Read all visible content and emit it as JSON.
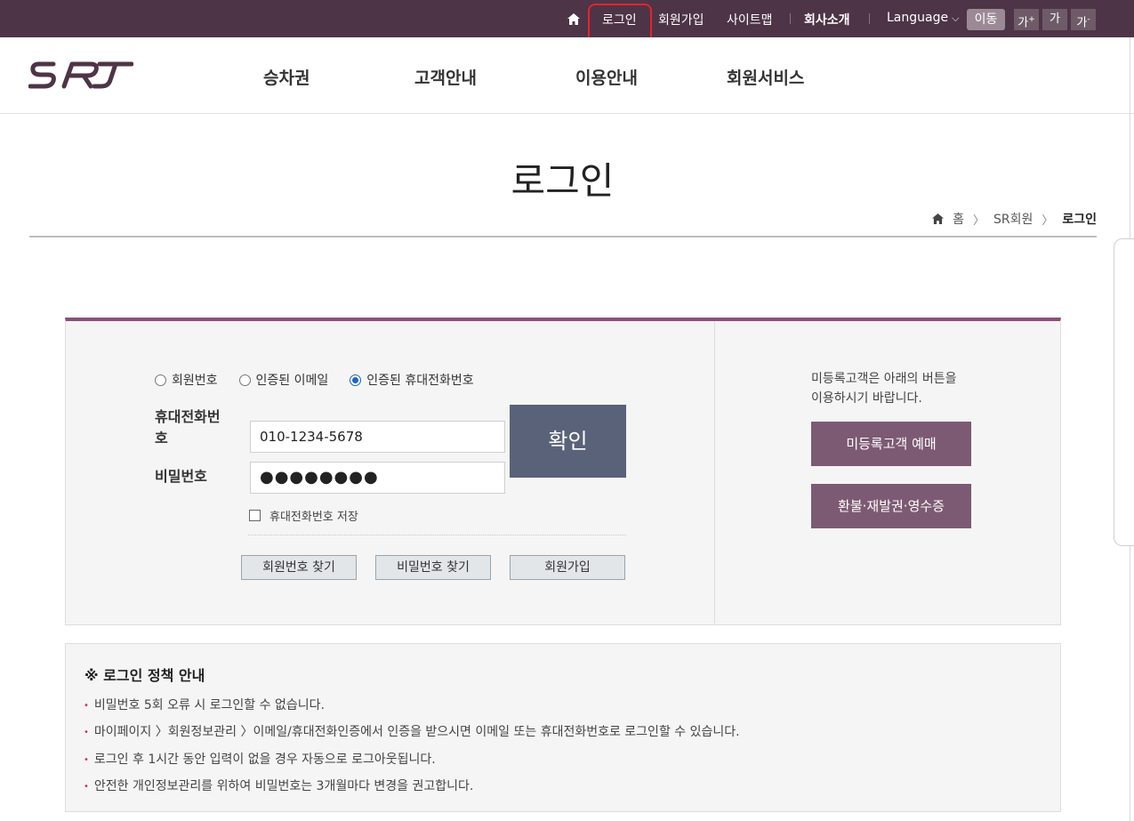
{
  "topbar": {
    "login": "로그인",
    "signup": "회원가입",
    "sitemap": "사이트맵",
    "company": "회사소개",
    "language": "Language",
    "move": "이동",
    "font_large": "가",
    "font_normal": "가",
    "font_small": "가"
  },
  "logo_text": "SRT",
  "gnb": {
    "ticket": "승차권",
    "customer": "고객안내",
    "usage": "이용안내",
    "member": "회원서비스"
  },
  "page": {
    "title": "로그인",
    "breadcrumb": [
      "홈",
      "SR회원",
      "로그인"
    ]
  },
  "login": {
    "radios": [
      {
        "label": "회원번호",
        "checked": false
      },
      {
        "label": "인증된 이메일",
        "checked": false
      },
      {
        "label": "인증된 휴대전화번호",
        "checked": true
      }
    ],
    "phone_label": "휴대전화번호",
    "phone_value": "010-1234-5678",
    "password_label": "비밀번호",
    "password_value": "●●●●●●●●",
    "confirm": "확인",
    "save_phone": "휴대전화번호 저장",
    "find_member": "회원번호 찾기",
    "find_password": "비밀번호 찾기",
    "join": "회원가입"
  },
  "guest": {
    "text_line1": "미등록고객은 아래의 버튼을",
    "text_line2": "이용하시기 바랍니다.",
    "reserve": "미등록고객 예매",
    "refund": "환불·재발권·영수증"
  },
  "policy": {
    "title": "※ 로그인 정책 안내",
    "items": [
      "비밀번호 5회 오류 시 로그인할 수 없습니다.",
      "마이페이지 〉회원정보관리 〉이메일/휴대전화인증에서 인증을 받으시면 이메일 또는 휴대전화번호로 로그인할 수 있습니다.",
      "로그인 후 1시간 동안 입력이 없을 경우 자동으로 로그아웃됩니다.",
      "안전한 개인정보관리를 위하여 비밀번호는 3개월마다 변경을 권고합니다."
    ]
  },
  "colors": {
    "topbar": "#4e3447",
    "accent": "#8d4d7b",
    "guest_button": "#7d5a73",
    "confirm_button": "#5a6279",
    "highlight": "#e2252a"
  }
}
